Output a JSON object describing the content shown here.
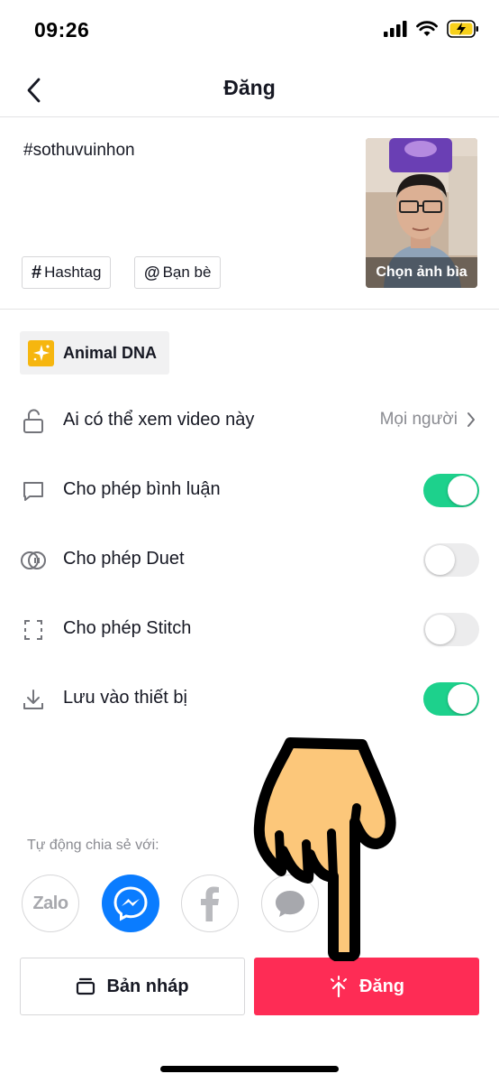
{
  "status_bar": {
    "time": "09:26"
  },
  "nav": {
    "title": "Đăng"
  },
  "post": {
    "caption": "#sothuvuinhon",
    "cover_label": "Chọn ảnh bìa",
    "hashtag_chip": "Hashtag",
    "friends_chip": "Bạn bè"
  },
  "effect": {
    "label": "Animal DNA",
    "icon": "sparkle-icon"
  },
  "settings": {
    "privacy": {
      "label": "Ai có thể xem video này",
      "value": "Mọi người",
      "icon": "lock-icon"
    },
    "comments": {
      "label": "Cho phép bình luận",
      "on": true,
      "icon": "comment-icon"
    },
    "duet": {
      "label": "Cho phép Duet",
      "on": false,
      "icon": "duet-icon"
    },
    "stitch": {
      "label": "Cho phép Stitch",
      "on": false,
      "icon": "stitch-icon"
    },
    "save": {
      "label": "Lưu vào thiết bị",
      "on": true,
      "icon": "download-icon"
    }
  },
  "share": {
    "label": "Tự động chia sẻ với:",
    "targets": [
      {
        "name": "Zalo",
        "icon": "zalo-icon"
      },
      {
        "name": "Messenger",
        "icon": "messenger-icon"
      },
      {
        "name": "Facebook",
        "icon": "facebook-icon"
      },
      {
        "name": "Message",
        "icon": "message-icon"
      }
    ]
  },
  "actions": {
    "draft_label": "Bản nháp",
    "post_label": "Đăng"
  },
  "colors": {
    "accent": "#fe2c55",
    "toggle_on": "#1dd18c",
    "messenger": "#0a7cff",
    "effect": "#f6b60f"
  }
}
